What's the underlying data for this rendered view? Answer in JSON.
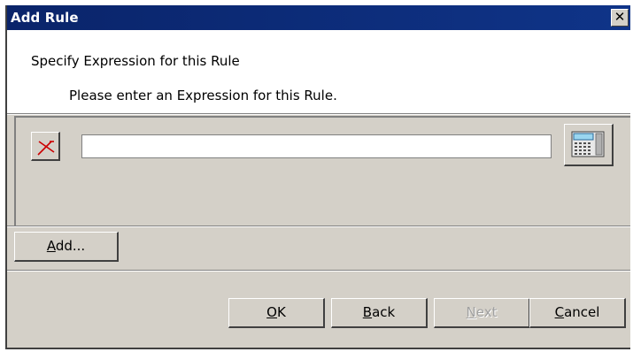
{
  "window": {
    "title": "Add Rule",
    "close_label": "✕"
  },
  "header": {
    "heading": "Specify Expression for this Rule",
    "subheading": "Please enter an Expression for this Rule."
  },
  "expression": {
    "value": "",
    "clear_icon": "red-x-clear-icon",
    "calculator_icon": "calculator-icon"
  },
  "buttons": {
    "add": {
      "mnemonic": "A",
      "rest": "dd..."
    },
    "ok": {
      "mnemonic": "O",
      "rest": "K"
    },
    "back": {
      "mnemonic": "B",
      "rest": "ack"
    },
    "next": {
      "mnemonic": "N",
      "rest": "ext",
      "disabled": true
    },
    "cancel": {
      "mnemonic": "C",
      "rest": "ancel"
    }
  },
  "colors": {
    "titlebar": "#0a246a",
    "face": "#d4d0c8",
    "clear_icon": "#cc0000"
  }
}
